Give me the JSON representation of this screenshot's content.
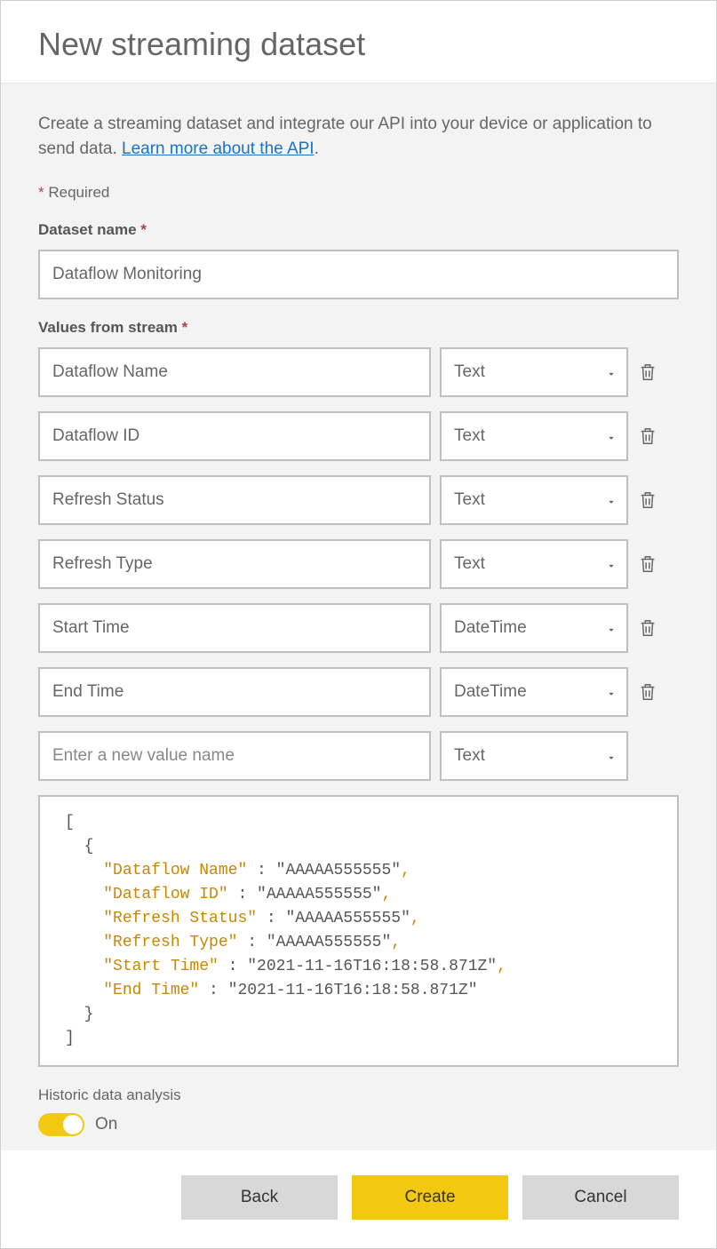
{
  "header": {
    "title": "New streaming dataset"
  },
  "intro": {
    "text_before": "Create a streaming dataset and integrate our API into your device or application to send data. ",
    "link_text": "Learn more about the API",
    "text_after": "."
  },
  "required_note": "Required",
  "dataset_name": {
    "label": "Dataset name",
    "value": "Dataflow Monitoring"
  },
  "values_from_stream": {
    "label": "Values from stream",
    "rows": [
      {
        "name": "Dataflow Name",
        "type": "Text"
      },
      {
        "name": "Dataflow ID",
        "type": "Text"
      },
      {
        "name": "Refresh Status",
        "type": "Text"
      },
      {
        "name": "Refresh Type",
        "type": "Text"
      },
      {
        "name": "Start Time",
        "type": "DateTime"
      },
      {
        "name": "End Time",
        "type": "DateTime"
      }
    ],
    "new_row": {
      "placeholder": "Enter a new value name",
      "type": "Text"
    }
  },
  "json_preview": {
    "lines": [
      {
        "indent": 0,
        "text": "["
      },
      {
        "indent": 1,
        "text": "{"
      },
      {
        "indent": 2,
        "key": "Dataflow Name",
        "value": "AAAAA555555",
        "comma": true
      },
      {
        "indent": 2,
        "key": "Dataflow ID",
        "value": "AAAAA555555",
        "comma": true
      },
      {
        "indent": 2,
        "key": "Refresh Status",
        "value": "AAAAA555555",
        "comma": true
      },
      {
        "indent": 2,
        "key": "Refresh Type",
        "value": "AAAAA555555",
        "comma": true
      },
      {
        "indent": 2,
        "key": "Start Time",
        "value": "2021-11-16T16:18:58.871Z",
        "comma": true
      },
      {
        "indent": 2,
        "key": "End Time",
        "value": "2021-11-16T16:18:58.871Z",
        "comma": false
      },
      {
        "indent": 1,
        "text": "}"
      },
      {
        "indent": 0,
        "text": "]"
      }
    ]
  },
  "historic": {
    "label": "Historic data analysis",
    "state_text": "On",
    "on": true
  },
  "footer": {
    "back": "Back",
    "create": "Create",
    "cancel": "Cancel"
  }
}
